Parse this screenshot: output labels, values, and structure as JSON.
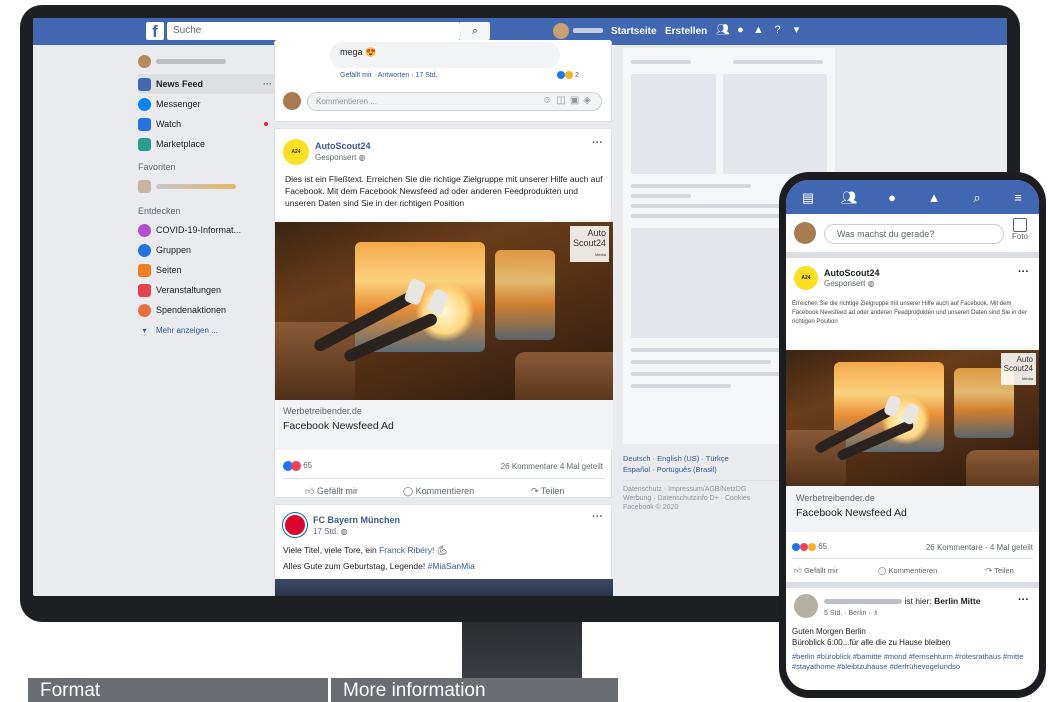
{
  "topbar": {
    "logo": "f",
    "search_placeholder": "Suche",
    "links": [
      "Startseite",
      "Erstellen"
    ]
  },
  "left_nav": {
    "items": [
      {
        "label": "News Feed",
        "color": "#4267b2"
      },
      {
        "label": "Messenger",
        "color": "#0084ff"
      },
      {
        "label": "Watch",
        "color": "#2374e1"
      },
      {
        "label": "Marketplace",
        "color": "#2a9d8f"
      }
    ],
    "favorites_title": "Favoriten",
    "discover_title": "Entdecken",
    "discover_items": [
      {
        "label": "COVID-19-Informat...",
        "color": "#b34fcf"
      },
      {
        "label": "Gruppen",
        "color": "#2374e1"
      },
      {
        "label": "Seiten",
        "color": "#f07d1e"
      },
      {
        "label": "Veranstaltungen",
        "color": "#e4434b"
      },
      {
        "label": "Spendenaktionen",
        "color": "#e8703c"
      }
    ],
    "more": "Mehr anzeigen ..."
  },
  "top_comment": {
    "text": "mega 😍",
    "actions": "Gefällt mir · Antworten · 17 Std.",
    "reactions_count": "2",
    "input_placeholder": "Kommentieren ..."
  },
  "ad_post": {
    "page_name": "AutoScout24",
    "sponsored": "Gesponsert",
    "text": "Dies ist ein Fließtext. Erreichen Sie die richtige Zielgruppe mit unserer Hilfe auch auf Facebook. Mit dem Facebook Newsfeed ad oder anderen Feedprodukten und unseren Daten sind Sie in der richtigen Position",
    "brand_line1": "Auto",
    "brand_line2": "Scout24",
    "brand_small": "Media",
    "domain": "Werbetreibender.de",
    "headline": "Facebook Newsfeed Ad",
    "reactions": "65",
    "stats": "26 Kommentare 4 Mal geteilt",
    "actions": [
      "Gefällt mir",
      "Kommentieren",
      "Teilen"
    ]
  },
  "fcb_post": {
    "page_name": "FC Bayern München",
    "time": "17 Std.",
    "line1_prefix": "Viele Titel, viele Tore, ein",
    "line1_link": "Franck Ribéry!",
    "line2": "Alles Gute zum Geburtstag, Legende!",
    "hashtag": "#MiaSanMia"
  },
  "right_col": {
    "languages_line1": "Deutsch · English (US) · Türkçe",
    "languages_line2": "Español · Português (Brasil)",
    "footer1": "Datenschutz · Impressum/AGB/NetzDG",
    "footer2": "Werbung · Datenschutzinfo D+ · Cookies",
    "copyright": "Facebook © 2020"
  },
  "phone": {
    "composer_placeholder": "Was machst du gerade?",
    "photo_label": "Foto",
    "ad_page": "AutoScout24",
    "ad_sponsored": "Gesponsert",
    "ad_text": "Erreichen Sie die richtige Zielgruppe mit unserer Hilfe auch auf Facebook. Mit dem Facebook Newsfeed ad oder anderen Feedprodukten und unseren Daten sind Sie in der richtigen Position",
    "brand_line1": "Auto",
    "brand_line2": "Scout24",
    "brand_small": "Media",
    "domain": "Werbetreibender.de",
    "headline": "Facebook Newsfeed Ad",
    "reactions": "65",
    "stats": "26 Kommentare · 4 Mal geteilt",
    "actions": [
      "Gefällt mir",
      "Kommentieren",
      "Teilen"
    ],
    "post2_suffix": "ist hier:",
    "post2_place": "Berlin Mitte",
    "post2_meta": "5 Std. · Berlin · ♗",
    "post2_line1": "Guten Morgen Berlin",
    "post2_line2": "Büroblick 6:00...für alle die zu Hause bleiben",
    "post2_tags": "#berlin #büroblick #bamitte #mond #fernsehturm #rotesrathaus #mitte #stayathome #bleibtzuhause #derfrühevogelundso"
  },
  "table": {
    "col1": "Format",
    "col2": "More information"
  }
}
